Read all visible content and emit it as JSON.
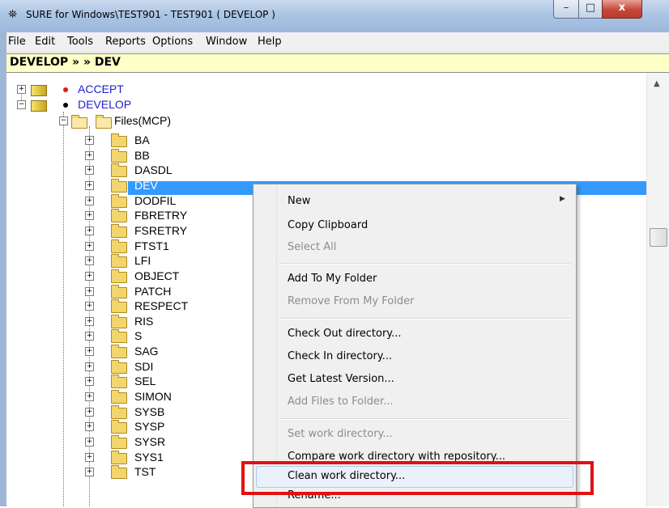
{
  "window": {
    "title": "SURE for Windows\\TEST901 - TEST901 ( DEVELOP )",
    "icon": "binoculars-icon",
    "controls": {
      "minimize": "–",
      "maximize": "□",
      "close": "x"
    }
  },
  "menubar": [
    "File",
    "Edit",
    "Tools",
    "Reports",
    "Options",
    "Window",
    "Help"
  ],
  "path": "DEVELOP » » DEV",
  "tree": {
    "roots": [
      {
        "label": "ACCEPT",
        "expanded": false,
        "dot_color": "#e01a1a"
      },
      {
        "label": "DEVELOP",
        "expanded": true,
        "dot_color": "#000000"
      }
    ],
    "files_node": "Files(MCP)",
    "folders": [
      "BA",
      "BB",
      "DASDL",
      "DEV",
      "DODFIL",
      "FBRETRY",
      "FSRETRY",
      "FTST1",
      "LFI",
      "OBJECT",
      "PATCH",
      "RESPECT",
      "RIS",
      "S",
      "SAG",
      "SDI",
      "SEL",
      "SIMON",
      "SYSB",
      "SYSP",
      "SYSR",
      "SYS1",
      "TST"
    ],
    "selected": "DEV"
  },
  "context_menu": {
    "items": [
      {
        "label": "New",
        "enabled": true,
        "submenu": true
      },
      {
        "label": "Copy Clipboard",
        "enabled": true
      },
      {
        "label": "Select All",
        "enabled": false
      },
      {
        "label": "Add To My Folder",
        "enabled": true
      },
      {
        "label": "Remove From My Folder",
        "enabled": false
      },
      {
        "label": "Check Out directory...",
        "enabled": true
      },
      {
        "label": "Check In directory...",
        "enabled": true
      },
      {
        "label": "Get Latest Version...",
        "enabled": true
      },
      {
        "label": "Add Files to Folder...",
        "enabled": false
      },
      {
        "label": "Set work directory...",
        "enabled": false
      },
      {
        "label": "Compare work directory with repository...",
        "enabled": true
      },
      {
        "label": "Clean work directory...",
        "enabled": true,
        "hovered": true
      },
      {
        "label": "Rename...",
        "enabled": true
      }
    ]
  },
  "colors": {
    "selection": "#3399ff",
    "highlight_box": "#e21010",
    "root_label": "#1f1fcf",
    "path_bar": "#ffffc8"
  }
}
